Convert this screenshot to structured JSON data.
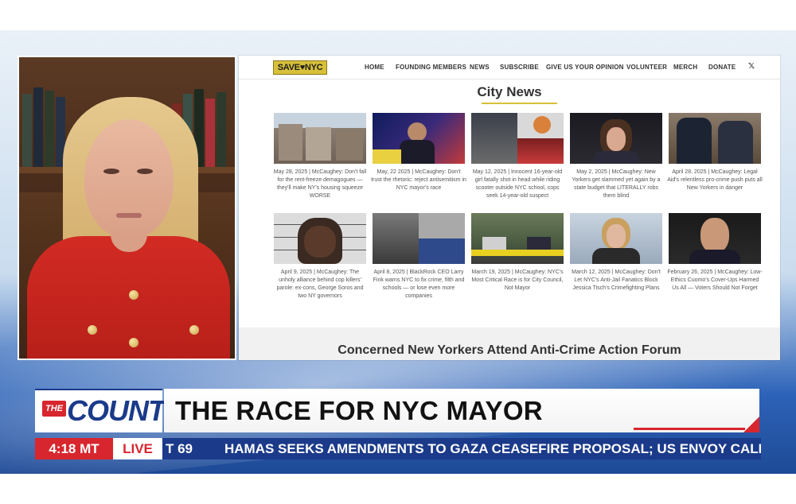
{
  "site": {
    "logo": "SAVE♥NYC",
    "nav": [
      {
        "label": "HOME"
      },
      {
        "label": "FOUNDING MEMBERS"
      },
      {
        "label": "NEWS"
      },
      {
        "label": "SUBSCRIBE"
      },
      {
        "label": "GIVE US YOUR OPINION"
      },
      {
        "label": "VOLUNTEER"
      },
      {
        "label": "MERCH"
      },
      {
        "label": "DONATE"
      },
      {
        "label": "𝕏"
      }
    ],
    "section_title": "City News",
    "articles": [
      {
        "caption": "May 28, 2025 | McCaughey: Don't fall for the rent-freeze demagogues — they'll make NY's housing squeeze WORSE"
      },
      {
        "caption": "May, 22 2025 | McCaughey: Don't trust the rhetoric: reject antisemitism in NYC mayor's race"
      },
      {
        "caption": "May 12, 2025 | Innocent 16-year-old girl fatally shot in head while riding scooter outside NYC school, cops seek 14-year-old suspect"
      },
      {
        "caption": "May 2, 2025 | McCaughey: New Yorkers get slammed yet again by a state budget that LITERALLY robs them blind"
      },
      {
        "caption": "April 28, 2025 | McCaughey: Legal Aid's relentless pro-crime push puts all New Yorkers in danger"
      },
      {
        "caption": "April 9, 2025 | McCaughey: The unholy alliance behind cop killers' parole: ex-cons, George Soros and two NY governors"
      },
      {
        "caption": "April 8, 2025 | BlackRock CEO Larry Fink warns NYC to fix crime, filth and schools — or lose even more companies"
      },
      {
        "caption": "March 19, 2025 | McCaughey: NYC's Most Critical Race is for City Council, Not Mayor"
      },
      {
        "caption": "March 12, 2025 | McCaughey: Don't Let NYC's Anti-Jail Fanatics Block Jessica Tisch's Crimefighting Plans"
      },
      {
        "caption": "February 26, 2025 | McCaughey: Low-Ethics Cuomo's Cover-Ups Harmed Us All — Voters Should Not Forget"
      }
    ],
    "forum_heading": "Concerned New Yorkers Attend Anti-Crime Action Forum"
  },
  "broadcast": {
    "brand_the": "THE",
    "brand_count": "COUNT",
    "headline": "THE RACE FOR NYC MAYOR",
    "time": "4:18 MT",
    "live": "LIVE",
    "ticker_prefix": "T 69",
    "ticker": "HAMAS SEEKS AMENDMENTS TO GAZA CEASEFIRE PROPOSAL; US ENVOY CALLS IT 'U"
  },
  "colors": {
    "brand_blue": "#1b3a8a",
    "brand_red": "#d7262e",
    "logo_gold": "#d8c03a"
  }
}
